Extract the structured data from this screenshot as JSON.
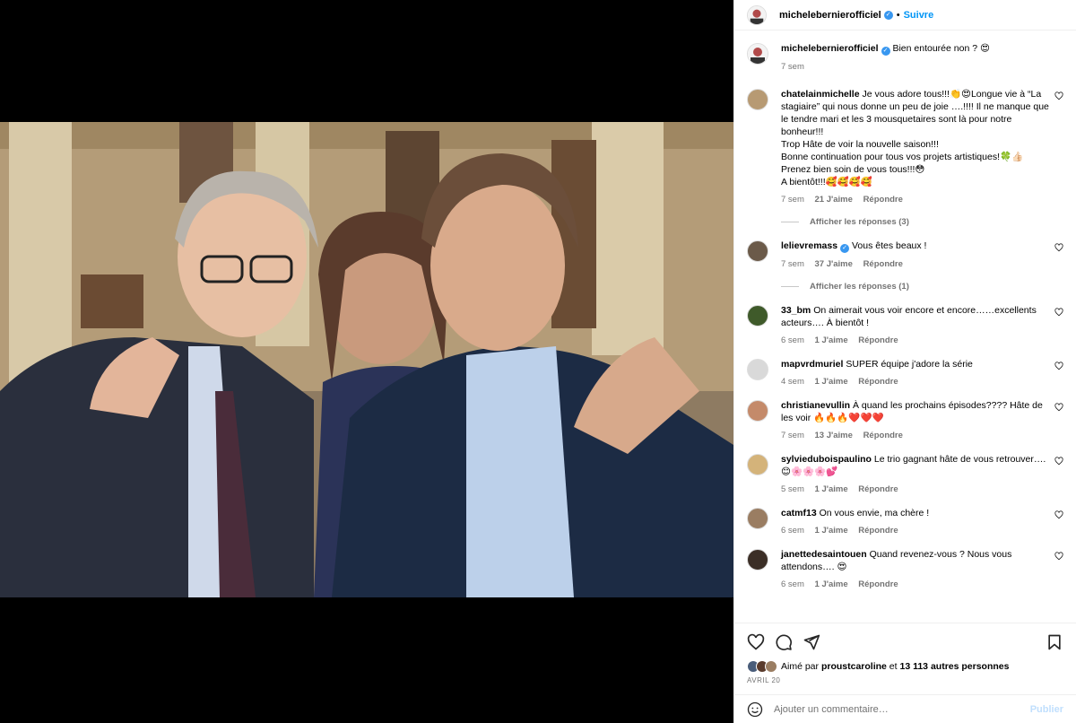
{
  "post": {
    "author": "michelebernierofficiel",
    "follow_label": "Suivre",
    "caption": "Bien entourée non ? 😍",
    "caption_time": "7 sem"
  },
  "comments": [
    {
      "user": "chatelainmichelle",
      "text": "Je vous adore tous!!!👏😍Longue vie à “La stagiaire” qui nous donne un peu de joie ….!!!! Il ne manque que le tendre mari et les 3 mousquetaires sont là pour notre bonheur!!!\nTrop Hâte de voir la nouvelle saison!!!\nBonne continuation pour tous vos projets artistiques!🍀👍🏻\nPrenez bien soin de vous tous!!!😳\nA bientôt!!!🥰🥰🥰🥰",
      "time": "7 sem",
      "likes": "21 J'aime",
      "reply": "Répondre",
      "replies": "Afficher les réponses (3)",
      "avatar_color": "#b79a73"
    },
    {
      "user": "lelievremass",
      "verified": true,
      "text": "Vous êtes beaux !",
      "time": "7 sem",
      "likes": "37 J'aime",
      "reply": "Répondre",
      "replies": "Afficher les réponses (1)",
      "avatar_color": "#6b5a49"
    },
    {
      "user": "33_bm",
      "text": "On aimerait vous voir encore et encore……excellents acteurs…. À bientôt !",
      "time": "6 sem",
      "likes": "1 J'aime",
      "reply": "Répondre",
      "avatar_color": "#3f5a2a"
    },
    {
      "user": "mapvrdmuriel",
      "text": "SUPER équipe j'adore la série",
      "time": "4 sem",
      "likes": "1 J'aime",
      "reply": "Répondre",
      "avatar_color": "#d9d9d9"
    },
    {
      "user": "christianevullin",
      "text": "À quand les prochains épisodes???? Hâte de les voir 🔥🔥🔥❤️❤️❤️",
      "time": "7 sem",
      "likes": "13 J'aime",
      "reply": "Répondre",
      "avatar_color": "#c48a6a"
    },
    {
      "user": "sylvieduboispaulino",
      "text": "Le trio gagnant hâte de vous retrouver….😊🌸🌸🌸💕",
      "time": "5 sem",
      "likes": "1 J'aime",
      "reply": "Répondre",
      "avatar_color": "#d4b37a"
    },
    {
      "user": "catmf13",
      "text": "On vous envie, ma chère !",
      "time": "6 sem",
      "likes": "1 J'aime",
      "reply": "Répondre",
      "avatar_color": "#9a7d62"
    },
    {
      "user": "janettedesaintouen",
      "text": "Quand revenez-vous ? Nous vous attendons…. 😍",
      "time": "6 sem",
      "likes": "1 J'aime",
      "reply": "Répondre",
      "avatar_color": "#3b2e26"
    }
  ],
  "likes_line": {
    "prefix": "Aimé par",
    "user": "proustcaroline",
    "middle": "et",
    "count": "13 113 autres personnes"
  },
  "date": "AVRIL 20",
  "add_comment": {
    "placeholder": "Ajouter un commentaire…",
    "post_label": "Publier"
  },
  "colors": {
    "link_blue": "#0095f6",
    "verified_blue": "#3897f0",
    "muted": "#737373"
  }
}
